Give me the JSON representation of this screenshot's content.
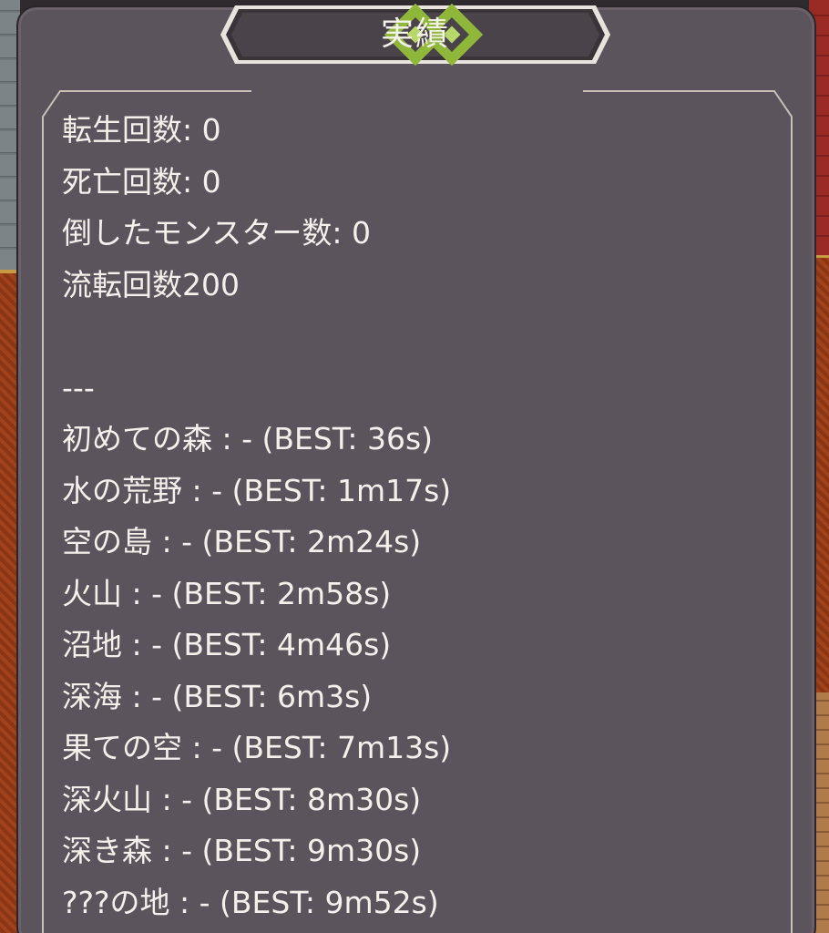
{
  "dialog": {
    "title": "実績"
  },
  "stats": {
    "reincarnations": "転生回数: 0",
    "deaths": "死亡回数: 0",
    "monsters_defeated": "倒したモンスター数: 0",
    "rutenkaisu": "流転回数200",
    "separator": "---"
  },
  "records": [
    "初めての森 : - (BEST: 36s)",
    "水の荒野 : - (BEST: 1m17s)",
    "空の島 : - (BEST: 2m24s)",
    "火山 : - (BEST: 2m58s)",
    "沼地 : - (BEST: 4m46s)",
    "深海 : - (BEST: 6m3s)",
    "果ての空 : - (BEST: 7m13s)",
    "深火山 : - (BEST: 8m30s)",
    "深き森 : - (BEST: 9m30s)",
    "???の地 : - (BEST: 9m52s)"
  ],
  "icons": {
    "title_left": "diamond-gem-icon",
    "title_right": "diamond-gem-icon"
  },
  "colors": {
    "panel_bg": "#5c545c",
    "text": "#f4f1ec",
    "gem": "#8fb83a",
    "frame_line": "#c9c0b6"
  }
}
